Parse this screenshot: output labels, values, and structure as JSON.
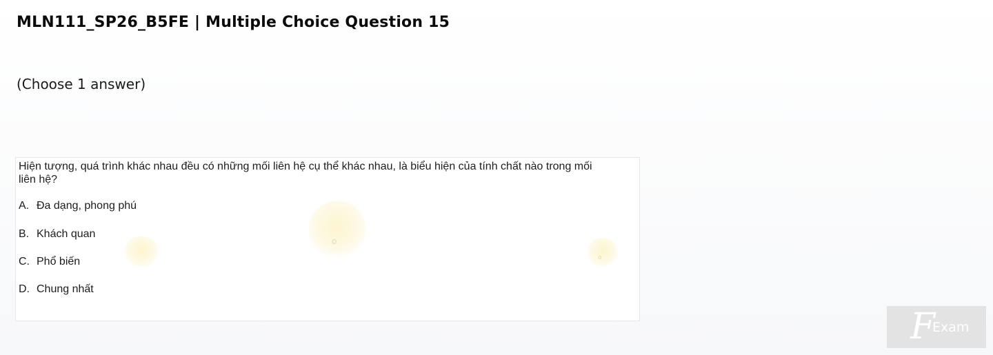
{
  "page": {
    "title": "MLN111_SP26_B5FE | Multiple Choice Question 15",
    "instruction": "(Choose 1 answer)"
  },
  "question": {
    "text": "Hiện tượng, quá trình khác nhau đều có những mối liên hệ cụ thể khác nhau, là biểu hiện của tính chất nào trong mối liên hệ?",
    "options": [
      {
        "letter": "A.",
        "text": "Đa dạng, phong phú"
      },
      {
        "letter": "B.",
        "text": "Khách quan"
      },
      {
        "letter": "C.",
        "text": "Phổ biến"
      },
      {
        "letter": "D.",
        "text": "Chung nhất"
      }
    ]
  },
  "watermark": {
    "logo_text": "Exam",
    "logo_glyph": "F"
  },
  "colors": {
    "background": "#f7f8fa",
    "card": "#ffffff",
    "card_border": "#e4e6ea",
    "watermark_bg": "#e3e3e3"
  }
}
